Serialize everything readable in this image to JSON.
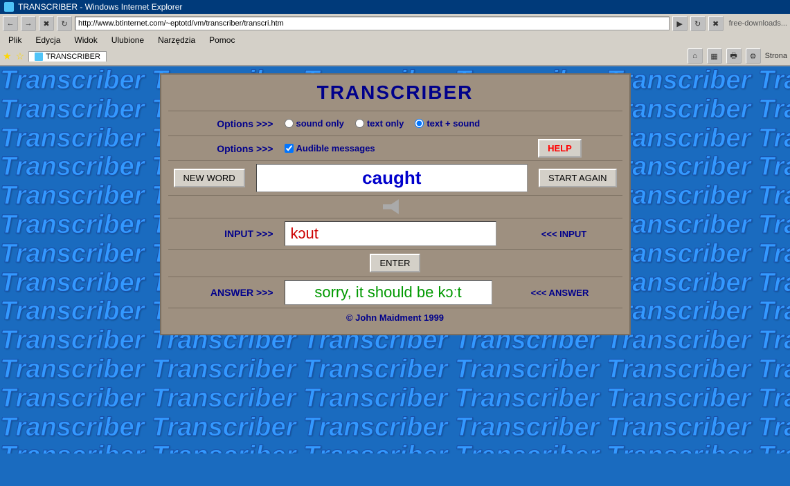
{
  "titlebar": {
    "icon": "e",
    "title": "TRANSCRIBER - Windows Internet Explorer"
  },
  "addressbar": {
    "url": "http://www.btinternet.com/~eptotd/vm/transcriber/transcri.htm"
  },
  "menubar": {
    "items": [
      "Plik",
      "Edycja",
      "Widok",
      "Ulubione",
      "Narzędzia",
      "Pomoc"
    ]
  },
  "favbar": {
    "tab_label": "TRANSCRIBER",
    "strona": "Strona"
  },
  "app": {
    "title": "TRANSCRIBER",
    "options_label": "Options >>>",
    "radio_options": [
      {
        "id": "sound_only",
        "label": "sound only",
        "checked": false
      },
      {
        "id": "text_only",
        "label": "text only",
        "checked": false
      },
      {
        "id": "text_sound",
        "label": "text + sound",
        "checked": true
      }
    ],
    "audible_label": "Audible messages",
    "help_label": "HELP",
    "new_word_label": "NEW WORD",
    "start_again_label": "START AGAIN",
    "word": "caught",
    "input_label": "INPUT >>>",
    "input_value": "kɔut",
    "enter_label": "ENTER",
    "answer_label": "ANSWER >>>",
    "answer_value": "sorry, it should be kɔːt",
    "answer_right_label": "<<< ANSWER",
    "input_right_label": "<<< INPUT",
    "footer": "© John Maidment 1999"
  },
  "bg": {
    "word": "Transcriber"
  }
}
